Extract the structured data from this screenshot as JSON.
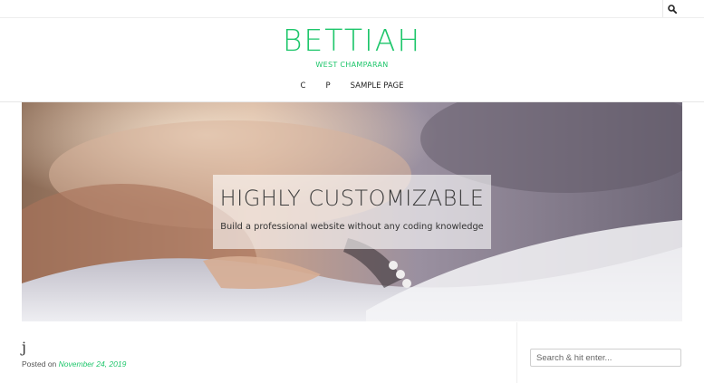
{
  "site": {
    "title": "BETTIAH",
    "tagline": "WEST CHAMPARAN",
    "accent_color": "#1ec66b"
  },
  "topbar": {
    "search_icon": "search-icon"
  },
  "nav": {
    "items": [
      "C",
      "P",
      "SAMPLE PAGE"
    ]
  },
  "hero": {
    "title": "HIGHLY CUSTOMIZABLE",
    "subtitle": "Build a professional website without any coding knowledge"
  },
  "post": {
    "title": "j",
    "posted_on_label": "Posted on",
    "date": "November 24, 2019"
  },
  "sidebar": {
    "search_placeholder": "Search & hit enter..."
  }
}
